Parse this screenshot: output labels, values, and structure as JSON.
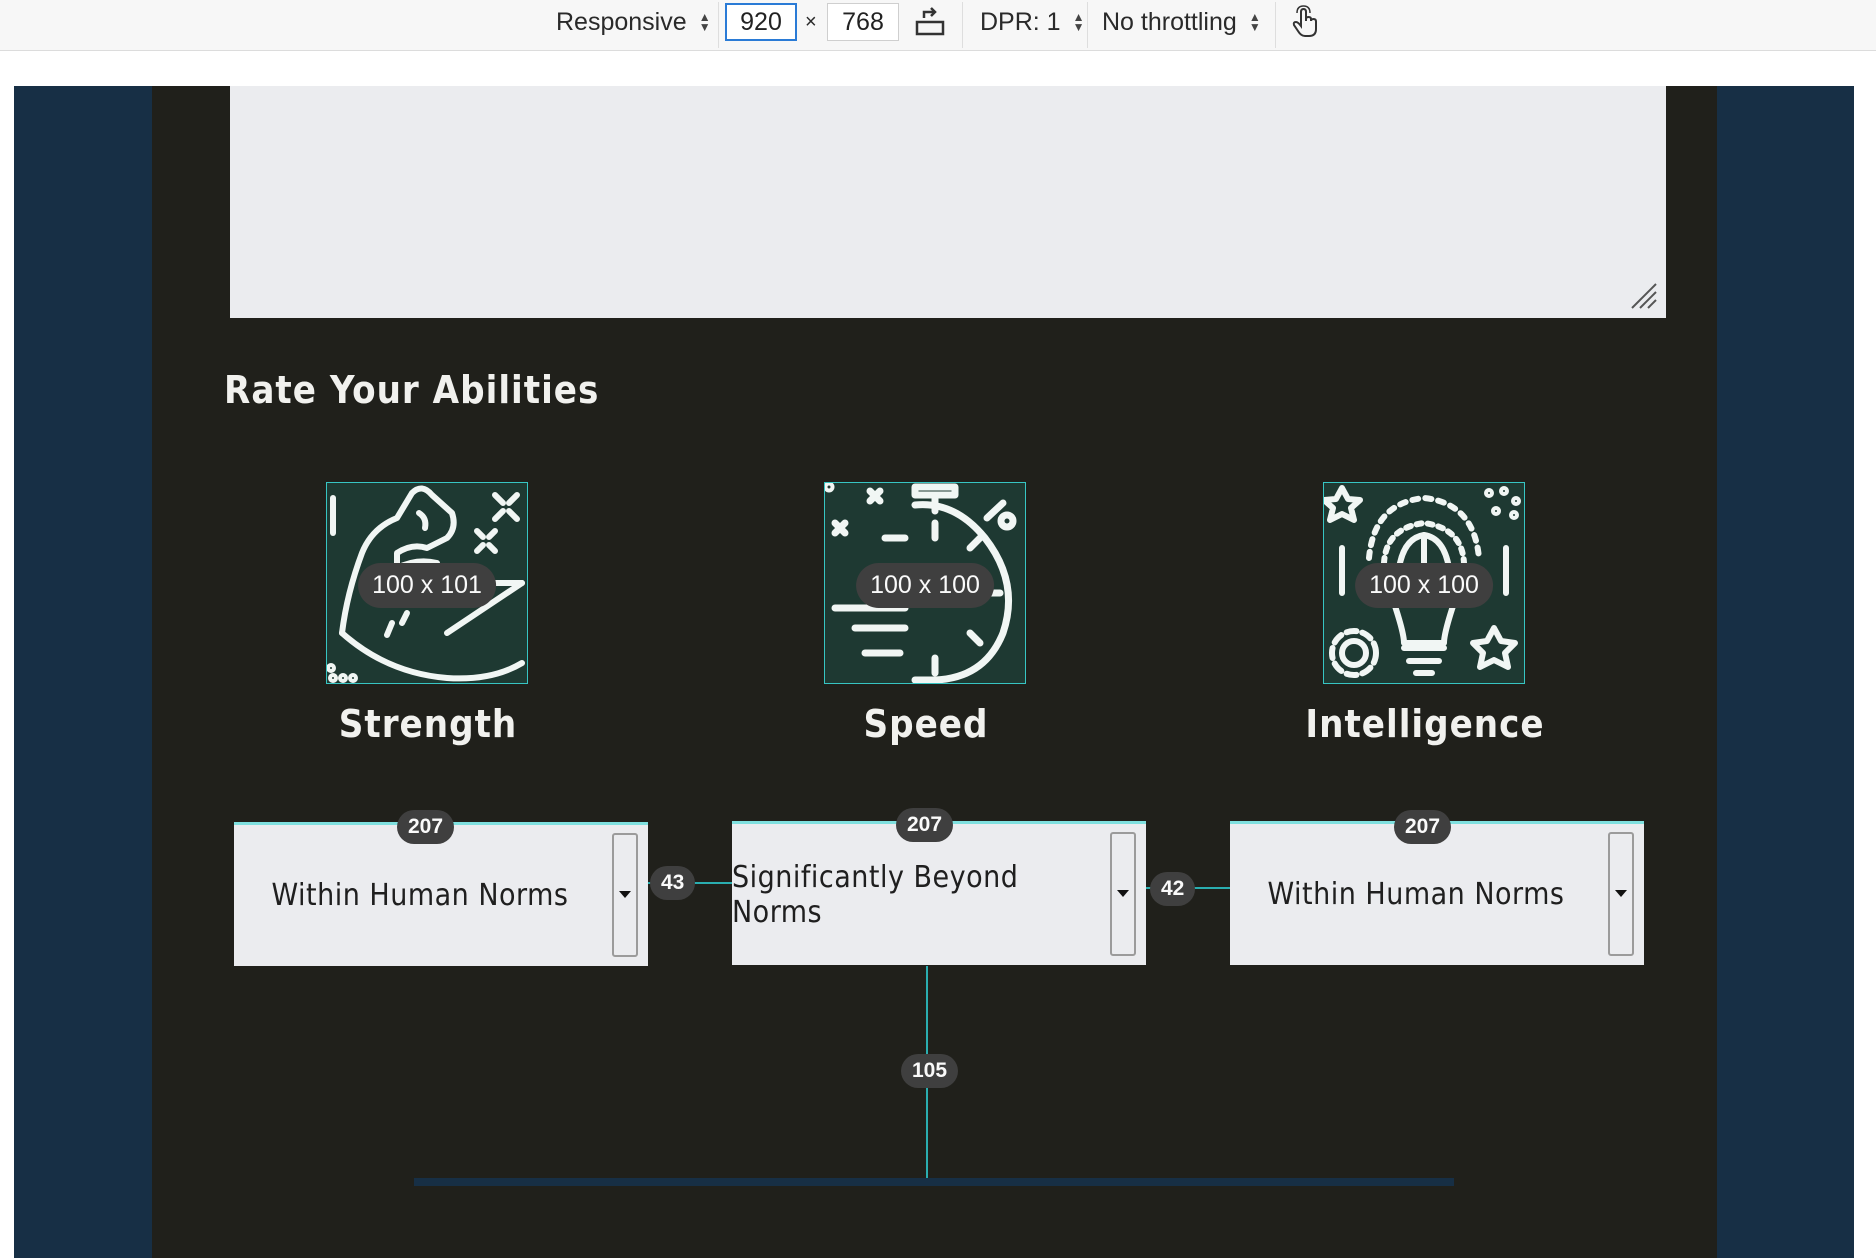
{
  "devtools": {
    "device": "Responsive",
    "width": "920",
    "times": "×",
    "height": "768",
    "dpr": "DPR: 1",
    "throttling": "No throttling",
    "rotate_icon": "rotate-icon",
    "touch_icon": "touch-icon"
  },
  "page": {
    "section_title": "Rate Your Abilities",
    "abilities": [
      {
        "label": "Strength",
        "icon": "flexed-arm-icon",
        "dims": "100 x 101",
        "select_value": "Within Human Norms"
      },
      {
        "label": "Speed",
        "icon": "stopwatch-icon",
        "dims": "100 x 100",
        "select_value": "Significantly Beyond Norms"
      },
      {
        "label": "Intelligence",
        "icon": "brain-bulb-icon",
        "dims": "100 x 100",
        "select_value": "Within Human Norms"
      }
    ]
  },
  "overlay": {
    "select_widths": [
      "207",
      "207",
      "207"
    ],
    "gaps": [
      "43",
      "42"
    ],
    "vertical_gap": "105"
  },
  "colors": {
    "page_bg": "#20201b",
    "side_bg": "#172f45",
    "icon_bg": "#1e3932",
    "guide": "#2aaeb0",
    "field_bg": "#ebecef"
  }
}
